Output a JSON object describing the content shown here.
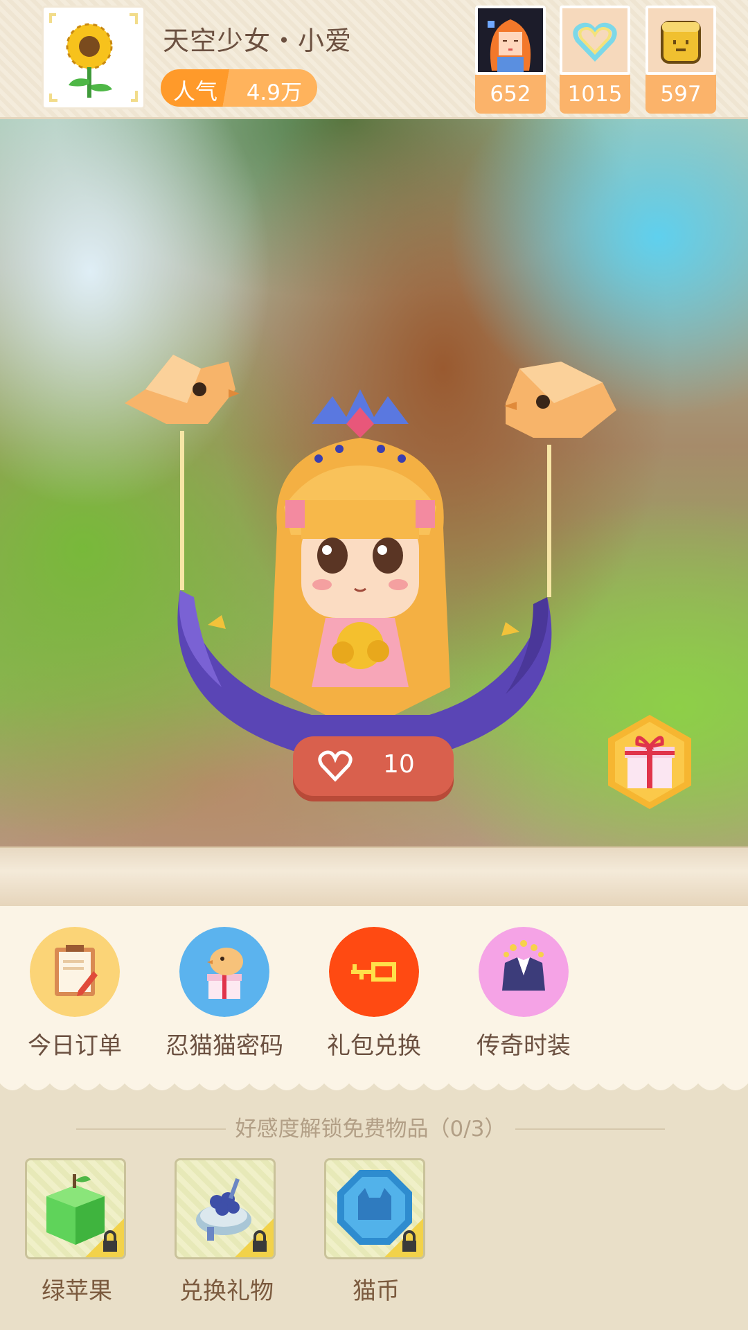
{
  "header": {
    "player_name": "天空少女・小爱",
    "popularity_label": "人气",
    "popularity_value": "4.9万",
    "currencies": [
      {
        "icon": "girl-portrait-icon",
        "count": "652"
      },
      {
        "icon": "rainbow-heart-icon",
        "count": "1015"
      },
      {
        "icon": "bread-icon",
        "count": "597"
      }
    ]
  },
  "scene": {
    "like_count": "10",
    "gift_icon": "gift-box-icon"
  },
  "features": [
    {
      "label": "今日订单",
      "icon": "clipboard-icon",
      "color": "#fbd477"
    },
    {
      "label": "忍猫猫密码",
      "icon": "chick-gift-icon",
      "color": "#5bb3ee"
    },
    {
      "label": "礼包兑换",
      "icon": "key-icon",
      "color": "#ff4a12"
    },
    {
      "label": "传奇时装",
      "icon": "suit-icon",
      "color": "#f5a3e6"
    }
  ],
  "unlock": {
    "title": "好感度解锁免费物品（0/3）",
    "items": [
      {
        "label": "绿苹果",
        "icon": "green-apple-icon"
      },
      {
        "label": "兑换礼物",
        "icon": "blueberry-cake-icon"
      },
      {
        "label": "猫币",
        "icon": "cat-coin-icon"
      }
    ]
  }
}
